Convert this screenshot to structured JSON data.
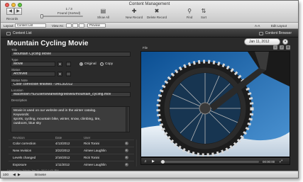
{
  "window": {
    "title": "Content Management"
  },
  "toolbar": {
    "records_label": "Records",
    "records_count": "1 / 3",
    "found_label": "Found (Sorted)",
    "buttons": [
      {
        "label": "Show All",
        "icon": "show-all-icon"
      },
      {
        "label": "New Record",
        "icon": "new-record-icon"
      },
      {
        "label": "Delete Record",
        "icon": "delete-record-icon"
      },
      {
        "label": "Find",
        "icon": "find-icon"
      },
      {
        "label": "Sort",
        "icon": "sort-icon"
      }
    ]
  },
  "layout_bar": {
    "layout_label": "Layout:",
    "layout_value": "Content List",
    "view_as_label": "View As:",
    "preview_label": "Preview",
    "aa_label": "A‑A",
    "edit_layout_label": "Edit Layout"
  },
  "content_bar": {
    "left_label": "Content List",
    "right_label": "Content Browser"
  },
  "record": {
    "title": "Mountain Cycling Movie",
    "date": "Jan 11, 2012",
    "fields": {
      "title_label": "Title",
      "title_value": "Mountain Cycling Movie",
      "type_label": "Type",
      "type_value": "Movie",
      "original_label": "Original",
      "copy_label": "Copy",
      "status_label": "Status",
      "status_value": "Archived",
      "status_note_label": "Status Note",
      "status_note_value": "Color correction finished - 04/13/2012",
      "location_label": "Location",
      "location_value": "Macintosh HD/Users/Marketing/Movies/mountain_cycling.mov",
      "description_label": "Description",
      "description_line1": "Movie is used on our website and  in the winter catalog.",
      "keywords_label": "Keywords:",
      "keywords_line1": "sports, cycling, mountain bike, winter, snow, climbing, tire,",
      "keywords_line2": "outdoors, blue sky"
    }
  },
  "revisions": {
    "headers": {
      "revision": "Revision",
      "date": "Date",
      "user": "User"
    },
    "rows": [
      {
        "revision": "Color correction",
        "date": "4/13/2012",
        "user": "Rick Tonini"
      },
      {
        "revision": "New revision",
        "date": "3/22/2012",
        "user": "Aimee Laughlin"
      },
      {
        "revision": "Levels changed",
        "date": "2/16/2012",
        "user": "Rick Tonini"
      },
      {
        "revision": "Exposure",
        "date": "1/11/2012",
        "user": "Aimee Laughlin"
      }
    ]
  },
  "updated_text": "Updated by Admin Jan 11, 2012 1:01 PM",
  "media": {
    "file_label": "File",
    "time": "00:00:00"
  },
  "status_bar": {
    "zoom": "100",
    "mode": "Browse"
  }
}
